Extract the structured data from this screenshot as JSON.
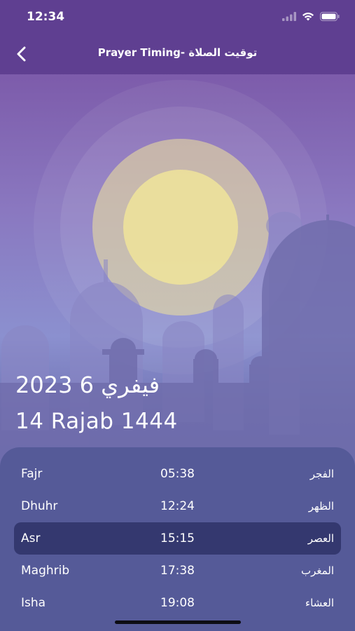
{
  "status_bar": {
    "time": "12:34"
  },
  "header": {
    "title": "Prayer Timing- توقيت الصلاة",
    "back_icon": "chevron-left-icon"
  },
  "dates": {
    "primary": "فيفري 6 2023",
    "hijri": "14 Rajab 1444"
  },
  "prayers": [
    {
      "name": "Fajr",
      "time": "05:38",
      "arabic": "الفجر",
      "active": false
    },
    {
      "name": "Dhuhr",
      "time": "12:24",
      "arabic": "الظهر",
      "active": false
    },
    {
      "name": "Asr",
      "time": "15:15",
      "arabic": "العصر",
      "active": true
    },
    {
      "name": "Maghrib",
      "time": "17:38",
      "arabic": "المغرب",
      "active": false
    },
    {
      "name": "Isha",
      "time": "19:08",
      "arabic": "العشاء",
      "active": false
    }
  ],
  "colors": {
    "header": "#5f3f91",
    "panel": "#555a98",
    "active_row": "#34386f",
    "sun": "#f0e49a"
  }
}
